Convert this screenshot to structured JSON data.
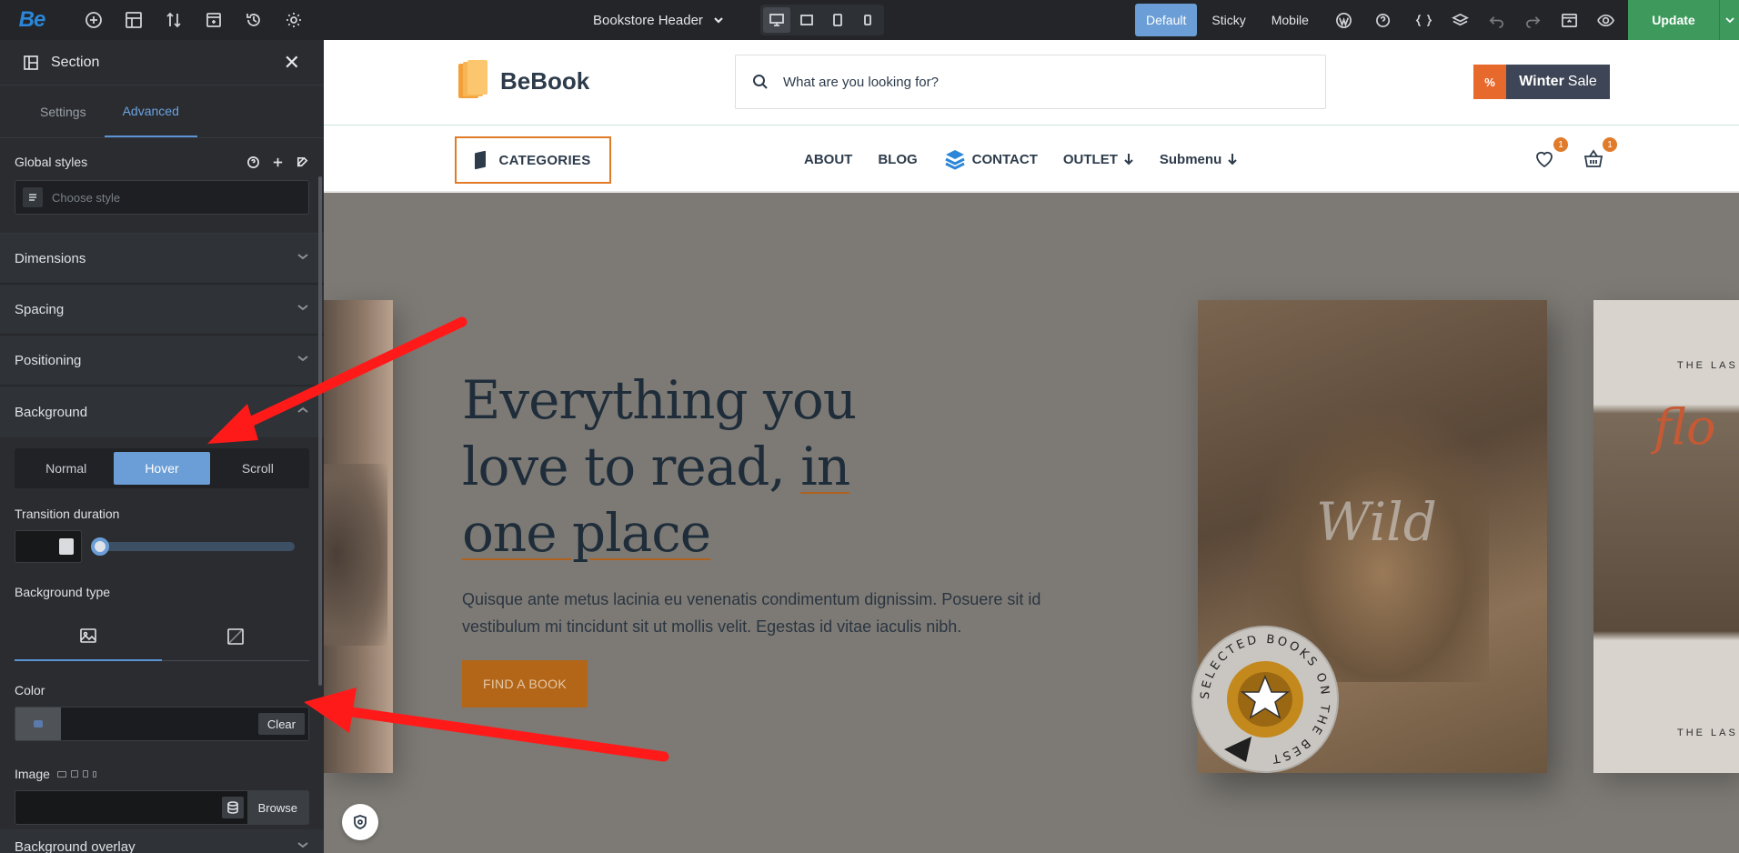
{
  "app": {
    "logo": "Be"
  },
  "topbar": {
    "doc_title": "Bookstore Header",
    "modes": [
      "Default",
      "Sticky",
      "Mobile"
    ],
    "update_label": "Update"
  },
  "sidebar": {
    "title": "Section",
    "tabs": [
      "Settings",
      "Advanced"
    ],
    "global_styles": {
      "label": "Global styles",
      "placeholder": "Choose style"
    },
    "accordions": [
      "Dimensions",
      "Spacing",
      "Positioning",
      "Background"
    ],
    "background": {
      "states": [
        "Normal",
        "Hover",
        "Scroll"
      ],
      "active_state": "Hover",
      "transition_label": "Transition duration",
      "transition_value": 0,
      "type_label": "Background type",
      "color_label": "Color",
      "clear_label": "Clear",
      "image_label": "Image",
      "browse_label": "Browse"
    },
    "overlay_label": "Background overlay"
  },
  "site": {
    "brand": "BeBook",
    "search_placeholder": "What are you looking for?",
    "sale": {
      "bold": "Winter",
      "rest": "Sale",
      "pct": "%"
    },
    "categories_label": "CATEGORIES",
    "nav": [
      {
        "label": "ABOUT"
      },
      {
        "label": "BLOG"
      },
      {
        "label": "CONTACT"
      },
      {
        "label": "OUTLET"
      },
      {
        "label": "Submenu"
      }
    ],
    "wishlist_count": "1",
    "cart_count": "1",
    "hero": {
      "title_line1": "Everything you",
      "title_line2a": "love to read, ",
      "title_line2b": "in",
      "title_line3": "one place",
      "subtitle": "Quisque ante metus lacinia eu venenatis condimentum dignissim. Posuere sit id vestibulum mi tincidunt sit ut mollis velit. Egestas id vitae iaculis nibh.",
      "cta": "FIND A BOOK"
    },
    "book_wild": "Wild",
    "book_right_top": "THE LAS",
    "book_right_bottom": "THE LAS",
    "book_right_script": "flo",
    "stamp_text": "SELECTED BOOKS ON THE BEST"
  },
  "colors": {
    "accent": "#6b9ed6",
    "update": "#3e9a5c",
    "orange": "#e07b2a",
    "cta": "#b36618",
    "annotation": "#ff1a1a"
  }
}
